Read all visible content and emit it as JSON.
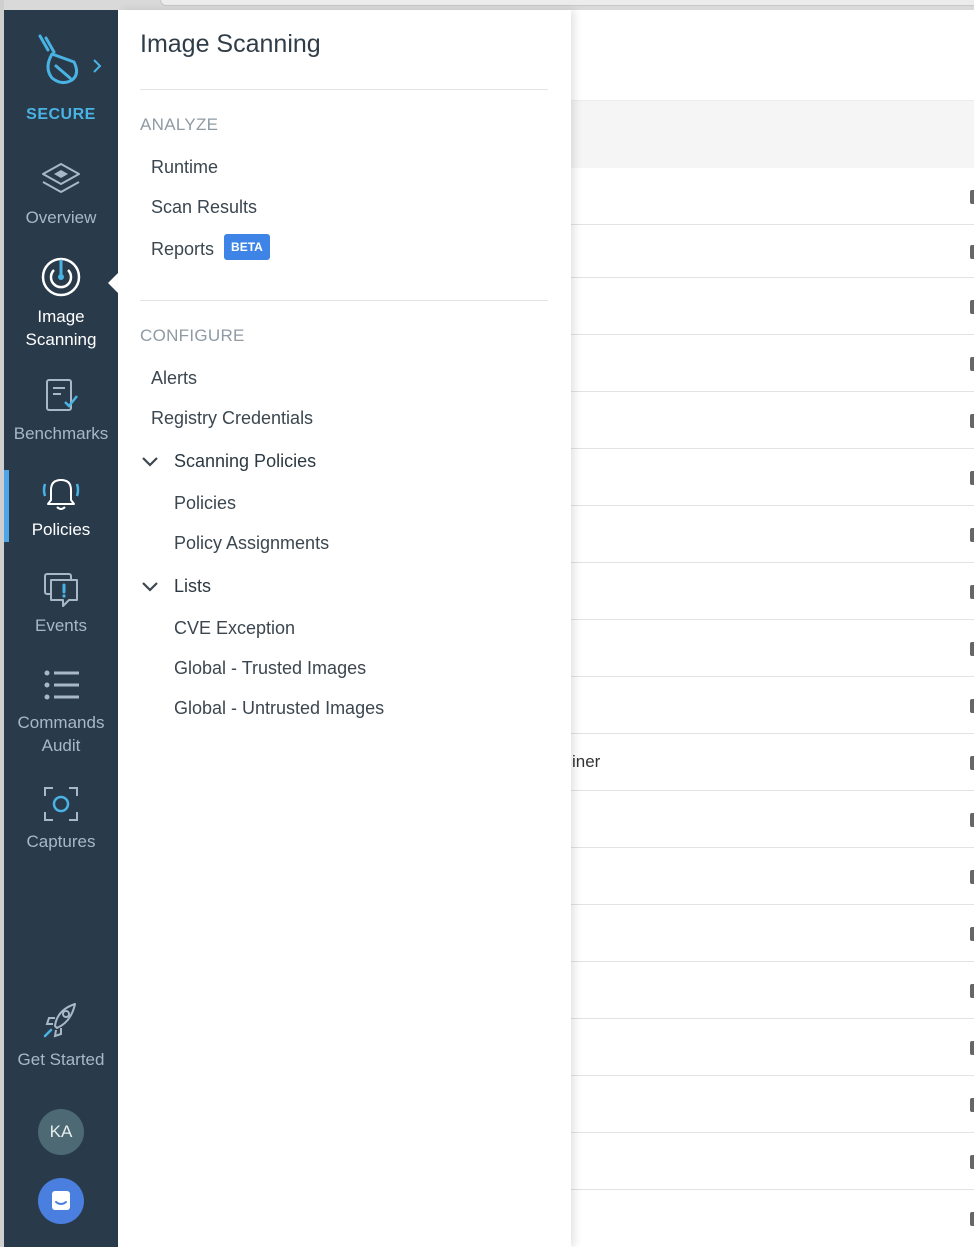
{
  "rail": {
    "product_label": "SECURE",
    "items": [
      {
        "label": "Overview",
        "icon": "layers-icon"
      },
      {
        "label": "Image\nScanning",
        "icon": "image-scanning-icon"
      },
      {
        "label": "Benchmarks",
        "icon": "benchmarks-icon"
      },
      {
        "label": "Policies",
        "icon": "bell-icon",
        "active": true
      },
      {
        "label": "Events",
        "icon": "events-icon"
      },
      {
        "label": "Commands\nAudit",
        "icon": "list-icon"
      },
      {
        "label": "Captures",
        "icon": "capture-icon"
      }
    ],
    "get_started": "Get Started",
    "avatar_initials": "KA",
    "accent_color": "#49b3e3",
    "rail_color": "#293a4b"
  },
  "panel": {
    "title": "Image Scanning",
    "analyze": {
      "label": "ANALYZE",
      "items": [
        "Runtime",
        "Scan Results",
        "Reports"
      ],
      "reports_badge": "BETA"
    },
    "configure": {
      "label": "CONFIGURE",
      "items": [
        "Alerts",
        "Registry Credentials"
      ],
      "scanning_policies": {
        "label": "Scanning Policies",
        "items": [
          "Policies",
          "Policy Assignments"
        ]
      },
      "lists": {
        "label": "Lists",
        "items": [
          "CVE Exception",
          "Global - Trusted Images",
          "Global - Untrusted Images"
        ]
      }
    },
    "badge_color": "#3d84e6"
  },
  "background": {
    "partial_row_text": "iner"
  }
}
